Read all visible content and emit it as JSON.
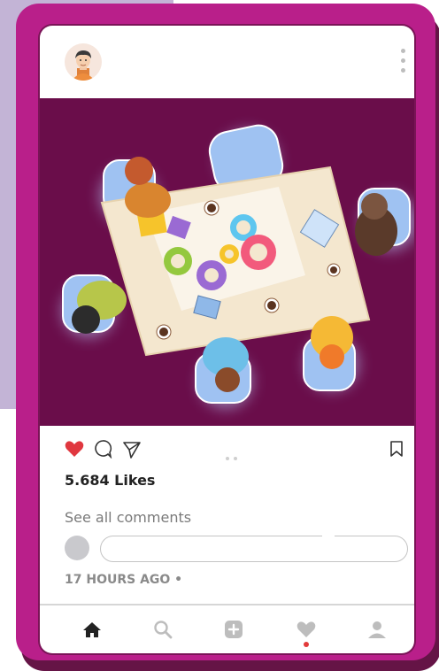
{
  "post": {
    "likes_text": "5.684 Likes",
    "see_comments_text": "See all comments",
    "comment_placeholder": "",
    "time_text": "17 HOURS AGO •"
  },
  "icons": {
    "like": "heart-icon",
    "comment": "comment-icon",
    "share": "send-icon",
    "save": "bookmark-icon",
    "menu": "kebab-menu-icon"
  },
  "tabbar": {
    "items": [
      "home-icon",
      "search-icon",
      "add-icon",
      "heart-icon",
      "profile-icon"
    ],
    "active": "home"
  },
  "colors": {
    "frame": "#b91f8a",
    "image_bg": "#6a0d4a",
    "like": "#e0373f",
    "notification": "#e23a3a"
  }
}
